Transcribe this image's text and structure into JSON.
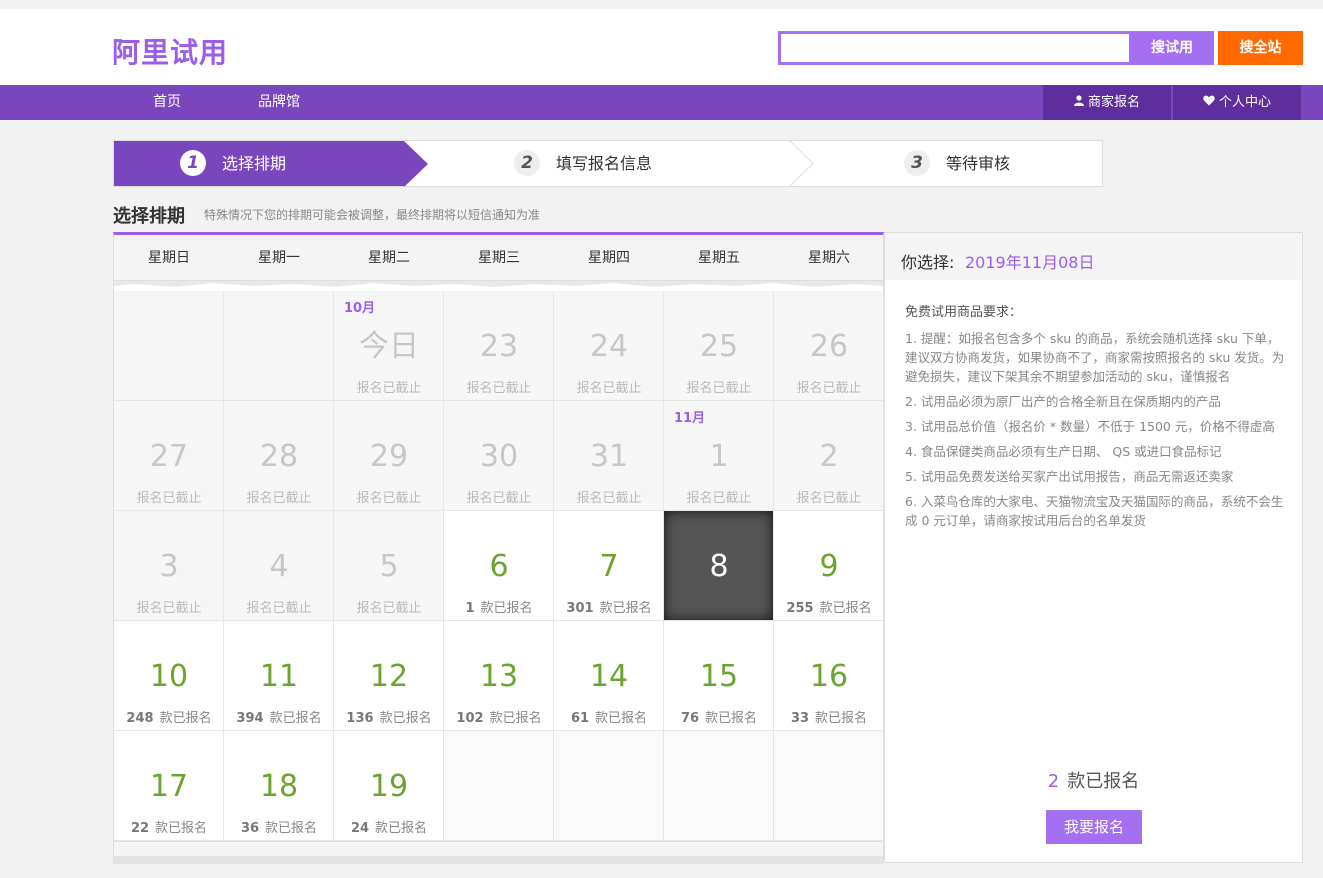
{
  "header": {
    "logo": "阿里试用",
    "search_placeholder": "",
    "search_trial_label": "搜试用",
    "search_all_label": "搜全站"
  },
  "nav": {
    "items": [
      "首页",
      "品牌馆"
    ],
    "merchant_signup": "商家报名",
    "personal_center": "个人中心"
  },
  "steps": [
    {
      "num": "1",
      "label": "选择排期"
    },
    {
      "num": "2",
      "label": "填写报名信息"
    },
    {
      "num": "3",
      "label": "等待审核"
    }
  ],
  "section": {
    "title": "选择排期",
    "note": "特殊情况下您的排期可能会被调整，最终排期将以短信通知为准"
  },
  "calendar": {
    "weekdays": [
      "星期日",
      "星期一",
      "星期二",
      "星期三",
      "星期四",
      "星期五",
      "星期六"
    ],
    "closed_text": "报名已截止",
    "count_suffix": "款已报名",
    "rows": [
      [
        {
          "kind": "empty-past"
        },
        {
          "kind": "empty-past"
        },
        {
          "kind": "past",
          "month": "10月",
          "day": "今日"
        },
        {
          "kind": "past",
          "day": "23"
        },
        {
          "kind": "past",
          "day": "24"
        },
        {
          "kind": "past",
          "day": "25"
        },
        {
          "kind": "past",
          "day": "26"
        }
      ],
      [
        {
          "kind": "past",
          "day": "27"
        },
        {
          "kind": "past",
          "day": "28"
        },
        {
          "kind": "past",
          "day": "29"
        },
        {
          "kind": "past",
          "day": "30"
        },
        {
          "kind": "past",
          "day": "31"
        },
        {
          "kind": "past",
          "month": "11月",
          "day": "1"
        },
        {
          "kind": "past",
          "day": "2"
        }
      ],
      [
        {
          "kind": "past",
          "day": "3"
        },
        {
          "kind": "past",
          "day": "4"
        },
        {
          "kind": "past",
          "day": "5"
        },
        {
          "kind": "future",
          "day": "6",
          "count": "1"
        },
        {
          "kind": "future",
          "day": "7",
          "count": "301"
        },
        {
          "kind": "selected",
          "day": "8"
        },
        {
          "kind": "future",
          "day": "9",
          "count": "255"
        }
      ],
      [
        {
          "kind": "future",
          "day": "10",
          "count": "248"
        },
        {
          "kind": "future",
          "day": "11",
          "count": "394"
        },
        {
          "kind": "future",
          "day": "12",
          "count": "136"
        },
        {
          "kind": "future",
          "day": "13",
          "count": "102"
        },
        {
          "kind": "future",
          "day": "14",
          "count": "61"
        },
        {
          "kind": "future",
          "day": "15",
          "count": "76"
        },
        {
          "kind": "future",
          "day": "16",
          "count": "33"
        }
      ],
      [
        {
          "kind": "future",
          "day": "17",
          "count": "22"
        },
        {
          "kind": "future",
          "day": "18",
          "count": "36"
        },
        {
          "kind": "future",
          "day": "19",
          "count": "24"
        },
        {
          "kind": "empty-future"
        },
        {
          "kind": "empty-future"
        },
        {
          "kind": "empty-future"
        },
        {
          "kind": "empty-future"
        }
      ]
    ]
  },
  "side": {
    "selected_label": "你选择:",
    "selected_date": "2019年11月08日",
    "req_title": "免费试用商品要求：",
    "requirements": [
      "1. 提醒：如报名包含多个 sku 的商品，系统会随机选择 sku 下单，建议双方协商发货，如果协商不了，商家需按照报名的 sku 发货。为避免损失，建议下架其余不期望参加活动的 sku，谨慎报名",
      "2. 试用品必须为原厂出产的合格全新且在保质期内的产品",
      "3. 试用品总价值（报名价 * 数量）不低于 1500 元，价格不得虚高",
      "4. 食品保健类商品必须有生产日期、 QS 或进口食品标记",
      "5. 试用品免费发送给买家产出试用报告，商品无需返还卖家",
      "6. 入菜鸟仓库的大家电、天猫物流宝及天猫国际的商品，系统不会生成 0 元订单，请商家按试用后台的名单发货"
    ],
    "count": "2",
    "count_suffix": "款已报名",
    "apply_label": "我要报名"
  },
  "colors": {
    "brand_purple": "#7a46bd",
    "light_purple": "#a46ff0",
    "orange": "#ff6a00",
    "available_green": "#6aa52f"
  }
}
